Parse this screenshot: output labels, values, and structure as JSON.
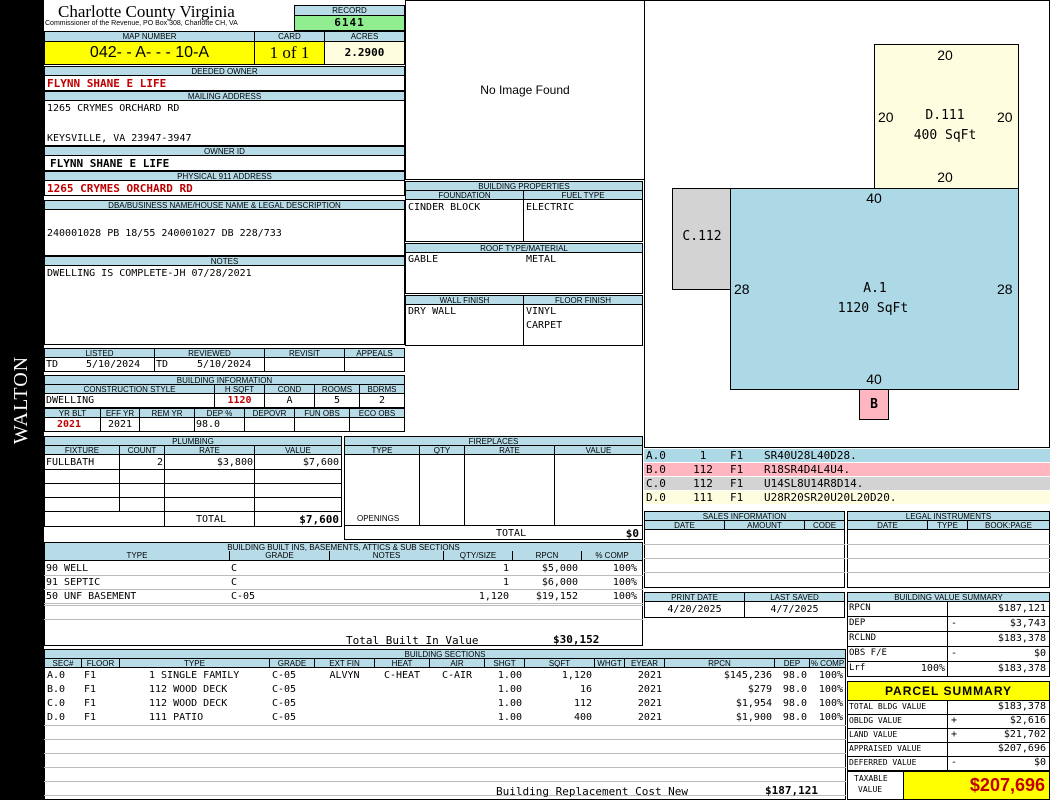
{
  "side_label": "WALTON",
  "header": {
    "county": "Charlotte County Virginia",
    "office": "Commissioner of the Revenue, PO Box 308, Charlotte CH, VA",
    "record_label": "RECORD",
    "record": "6141",
    "map_label": "MAP NUMBER",
    "map_number": "042- - A- - - 10-A",
    "card_label": "CARD",
    "card": "1 of 1",
    "acres_label": "ACRES",
    "acres": "2.2900"
  },
  "owner": {
    "deeded_label": "DEEDED OWNER",
    "deeded_owner": "FLYNN SHANE E LIFE",
    "mailing_label": "MAILING ADDRESS",
    "address1": "1265 CRYMES ORCHARD RD",
    "address2": "KEYSVILLE, VA 23947-3947",
    "ownerid_label": "OWNER ID",
    "owner_id": "FLYNN SHANE E LIFE",
    "phys_label": "PHYSICAL 911 ADDRESS",
    "physical_address": "1265 CRYMES ORCHARD RD",
    "legal_label": "DBA/BUSINESS NAME/HOUSE NAME & LEGAL DESCRIPTION",
    "legal": "240001028 PB 18/55 240001027 DB 228/733",
    "notes_label": "NOTES",
    "notes": "DWELLING IS COMPLETE-JH 07/28/2021"
  },
  "image": {
    "placeholder": "No Image Found"
  },
  "building_properties": {
    "title": "BUILDING PROPERTIES",
    "foundation_label": "FOUNDATION",
    "foundation": "CINDER BLOCK",
    "fuel_label": "FUEL TYPE",
    "fuel": "ELECTRIC",
    "roof_label": "ROOF TYPE/MATERIAL",
    "roof_type": "GABLE",
    "roof_material": "METAL",
    "wall_label": "WALL FINISH",
    "wall": "DRY WALL",
    "floor_label": "FLOOR FINISH",
    "floor1": "VINYL",
    "floor2": "CARPET"
  },
  "review": {
    "listed_label": "LISTED",
    "reviewed_label": "REVIEWED",
    "revisit_label": "REVISIT",
    "appeals_label": "APPEALS",
    "listed_code": "TD",
    "listed_date": "5/10/2024",
    "reviewed_code": "TD",
    "reviewed_date": "5/10/2024"
  },
  "building_info": {
    "title": "BUILDING INFORMATION",
    "style_label": "CONSTRUCTION STYLE",
    "hsqft_label": "H SQFT",
    "cond_label": "COND",
    "rooms_label": "ROOMS",
    "bdrms_label": "BDRMS",
    "style": "DWELLING",
    "hsqft": "1120",
    "cond": "A",
    "rooms": "5",
    "bdrms": "2",
    "yrblt_label": "YR BLT",
    "effyr_label": "EFF YR",
    "remyr_label": "REM YR",
    "dep_label": "DEP %",
    "depovr_label": "DEPOVR",
    "funobs_label": "FUN OBS",
    "ecoobs_label": "ECO OBS",
    "yrblt": "2021",
    "effyr": "2021",
    "dep": "98.0"
  },
  "plumbing": {
    "title": "PLUMBING",
    "headers": [
      "FIXTURE",
      "COUNT",
      "RATE",
      "VALUE"
    ],
    "rows": [
      [
        "FULLBATH",
        "2",
        "$3,800",
        "$7,600"
      ]
    ],
    "total_label": "TOTAL",
    "total": "$7,600"
  },
  "fireplaces": {
    "title": "FIREPLACES",
    "headers": [
      "TYPE",
      "QTY",
      "RATE",
      "VALUE"
    ],
    "openings_label": "OPENINGS",
    "total_label": "TOTAL",
    "total": "$0"
  },
  "builtins": {
    "title": "BUILDING BUILT INS, BASEMENTS, ATTICS & SUB SECTIONS",
    "headers": [
      "TYPE",
      "GRADE",
      "NOTES",
      "QTY/SIZE",
      "RPCN",
      "% COMP"
    ],
    "rows": [
      [
        "90 WELL",
        "C",
        "",
        "1",
        "$5,000",
        "100%"
      ],
      [
        "91 SEPTIC",
        "C",
        "",
        "1",
        "$6,000",
        "100%"
      ],
      [
        "50 UNF BASEMENT",
        "C-05",
        "",
        "1,120",
        "$19,152",
        "100%"
      ]
    ],
    "total_label": "Total Built In Value",
    "total": "$30,152"
  },
  "sections": {
    "title": "BUILDING SECTIONS",
    "headers": [
      "SEC#",
      "FLOOR",
      "TYPE",
      "GRADE",
      "EXT FIN",
      "HEAT",
      "AIR",
      "SHGT",
      "SQFT",
      "WHGT",
      "EYEAR",
      "RPCN",
      "DEP",
      "% COMP"
    ],
    "rows": [
      [
        "A.0",
        "F1",
        "1 SINGLE FAMILY",
        "C-05",
        "ALVYN",
        "C-HEAT",
        "C-AIR",
        "1.00",
        "1,120",
        "",
        "2021",
        "$145,236",
        "98.0",
        "100%"
      ],
      [
        "B.0",
        "F1",
        "112 WOOD DECK",
        "C-05",
        "",
        "",
        "",
        "1.00",
        "16",
        "",
        "2021",
        "$279",
        "98.0",
        "100%"
      ],
      [
        "C.0",
        "F1",
        "112 WOOD DECK",
        "C-05",
        "",
        "",
        "",
        "1.00",
        "112",
        "",
        "2021",
        "$1,954",
        "98.0",
        "100%"
      ],
      [
        "D.0",
        "F1",
        "111 PATIO",
        "C-05",
        "",
        "",
        "",
        "1.00",
        "400",
        "",
        "2021",
        "$1,900",
        "98.0",
        "100%"
      ]
    ],
    "brcn_label": "Building Replacement Cost New",
    "brcn": "$187,121"
  },
  "sketch": {
    "d_label": "D.111",
    "d_area": "400 SqFt",
    "d_top": "20",
    "d_left": "20",
    "d_right": "20",
    "d_bottom": "20",
    "a_label": "A.1",
    "a_area": "1120 SqFt",
    "a_top": "40",
    "a_left": "28",
    "a_right": "28",
    "a_bottom": "40",
    "c_label": "C.112",
    "b_label": "B",
    "colors": {
      "a": "#add8e6",
      "b": "#ffb6c1",
      "c": "#d3d3d3",
      "d": "#fffde0"
    }
  },
  "vectors": [
    {
      "sec": "A.0",
      "n": "1",
      "f": "F1",
      "path": "SR40U28L40D28."
    },
    {
      "sec": "B.0",
      "n": "112",
      "f": "F1",
      "path": "R18SR4D4L4U4."
    },
    {
      "sec": "C.0",
      "n": "112",
      "f": "F1",
      "path": "U14SL8U14R8D14."
    },
    {
      "sec": "D.0",
      "n": "111",
      "f": "F1",
      "path": "U28R20SR20U20L20D20."
    }
  ],
  "sales": {
    "title": "SALES INFORMATION",
    "headers": [
      "DATE",
      "AMOUNT",
      "CODE"
    ]
  },
  "legal_instruments": {
    "title": "LEGAL INSTRUMENTS",
    "headers": [
      "DATE",
      "TYPE",
      "BOOK:PAGE"
    ]
  },
  "dates": {
    "print_label": "PRINT DATE",
    "print_date": "4/20/2025",
    "saved_label": "LAST SAVED",
    "saved_date": "4/7/2025"
  },
  "bvs": {
    "title": "BUILDING VALUE SUMMARY",
    "rows": [
      {
        "label": "RPCN",
        "sign": "",
        "value": "$187,121"
      },
      {
        "label": "DEP",
        "sign": "-",
        "value": "$3,743"
      },
      {
        "label": "RCLND",
        "sign": "",
        "value": "$183,378"
      },
      {
        "label": "OBS F/E",
        "sign": "-",
        "value": "$0"
      },
      {
        "label": "Lrf",
        "pct": "100%",
        "sign": "",
        "value": "$183,378"
      }
    ]
  },
  "parcel": {
    "title": "PARCEL SUMMARY",
    "rows": [
      {
        "label": "TOTAL BLDG VALUE",
        "sign": "",
        "value": "$183,378"
      },
      {
        "label": "OBLDG VALUE",
        "sign": "+",
        "value": "$2,616"
      },
      {
        "label": "LAND VALUE",
        "sign": "+",
        "value": "$21,702"
      },
      {
        "label": "APPRAISED VALUE",
        "sign": "",
        "value": "$207,696"
      },
      {
        "label": "DEFERRED VALUE",
        "sign": "-",
        "value": "$0"
      }
    ],
    "taxable_label1": "TAXABLE",
    "taxable_label2": "VALUE",
    "taxable": "$207,696"
  }
}
